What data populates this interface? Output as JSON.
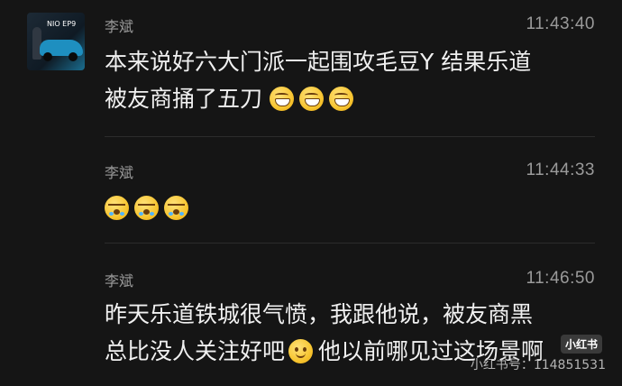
{
  "messages": [
    {
      "sender": "李斌",
      "time": "11:43:40",
      "lines": [
        "本来说好六大门派一起围攻毛豆Y 结果乐道",
        "被友商捅了五刀"
      ],
      "trailing_emojis": [
        "grinning-face-icon",
        "grinning-face-icon",
        "grinning-face-icon"
      ],
      "avatar": {
        "brand": "NIO EP9"
      }
    },
    {
      "sender": "李斌",
      "time": "11:44:33",
      "lines": [],
      "trailing_emojis": [
        "crying-face-icon",
        "crying-face-icon",
        "crying-face-icon"
      ]
    },
    {
      "sender": "李斌",
      "time": "11:46:50",
      "lines": [
        "昨天乐道铁城很气愤，我跟他说，被友商黑",
        "总比没人关注好吧",
        "他以前哪见过这场景啊"
      ],
      "inline_emoji": "smiling-face-icon"
    }
  ],
  "watermark": {
    "badge": "小红书",
    "id_text": "小红书号：114851531"
  },
  "colors": {
    "background": "#151515",
    "text": "#f0f0f0",
    "meta": "#9a9a9a"
  }
}
